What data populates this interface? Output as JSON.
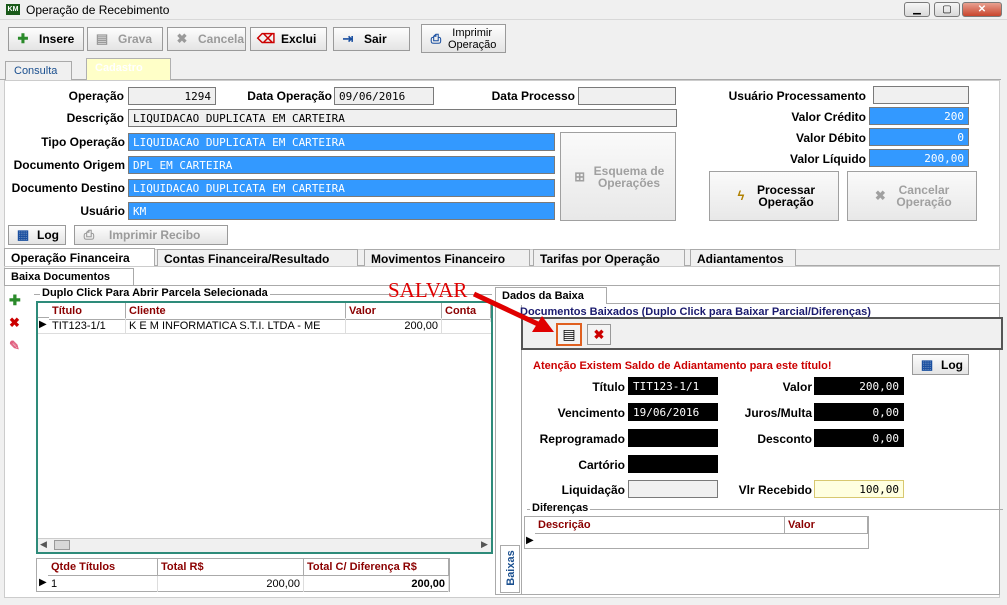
{
  "window": {
    "title": "Operação de Recebimento",
    "icon": "KM"
  },
  "toolbar": {
    "insere": "Insere",
    "grava": "Grava",
    "cancela": "Cancela",
    "exclui": "Exclui",
    "sair": "Sair",
    "imprimir_l1": "Imprimir",
    "imprimir_l2": "Operação"
  },
  "tabs": {
    "consulta": "Consulta",
    "cadastro": "Cadastro"
  },
  "form": {
    "operacao_label": "Operação",
    "operacao": "1294",
    "data_operacao_label": "Data Operação",
    "data_operacao": "09/06/2016",
    "data_processo_label": "Data Processo",
    "data_processo": "",
    "descricao_label": "Descrição",
    "descricao": "LIQUIDACAO DUPLICATA EM CARTEIRA",
    "tipo_operacao_label": "Tipo Operação",
    "tipo_operacao": "LIQUIDACAO DUPLICATA EM CARTEIRA",
    "doc_origem_label": "Documento Origem",
    "doc_origem": "DPL EM CARTEIRA",
    "doc_destino_label": "Documento Destino",
    "doc_destino": "LIQUIDACAO DUPLICATA EM CARTEIRA",
    "usuario_label": "Usuário",
    "usuario": "KM",
    "usuario_proc_label": "Usuário Processamento",
    "usuario_proc": "",
    "valor_credito_label": "Valor Crédito",
    "valor_credito": "200",
    "valor_debito_label": "Valor Débito",
    "valor_debito": "0",
    "valor_liquido_label": "Valor Líquido",
    "valor_liquido": "200,00"
  },
  "buttons": {
    "esquema_l1": "Esquema de",
    "esquema_l2": "Operações",
    "processar_l1": "Processar",
    "processar_l2": "Operação",
    "cancelar_l1": "Cancelar",
    "cancelar_l2": "Operação",
    "log": "Log",
    "imprimir_recibo": "Imprimir Recibo"
  },
  "subtabs": [
    "Operação Financeira",
    "Contas Financeira/Resultado",
    "Movimentos Financeiro",
    "Tarifas por Operação",
    "Adiantamentos"
  ],
  "baixa_docs": {
    "title": "Baixa Documentos",
    "group": "Duplo Click Para Abrir Parcela Selecionada",
    "columns": [
      "Título",
      "Cliente",
      "Valor",
      "Conta"
    ],
    "rows": [
      {
        "titulo": "TIT123-1/1",
        "cliente": "K E M INFORMATICA S.T.I. LTDA - ME",
        "valor": "200,00",
        "conta": ""
      }
    ],
    "summary_cols": [
      "Qtde Títulos",
      "Total R$",
      "Total C/ Diferença R$"
    ],
    "summary": {
      "qtde": "1",
      "total": "200,00",
      "total_dif": "200,00"
    }
  },
  "annotation": "SALVAR",
  "dados_baixa": {
    "tab": "Dados da Baixa",
    "group": "Documentos Baixados (Duplo Click para Baixar Parcial/Diferenças)",
    "warning": "Atenção Existem Saldo de Adiantamento para este título!",
    "log": "Log",
    "titulo_label": "Título",
    "titulo": "TIT123-1/1",
    "valor_label": "Valor",
    "valor": "200,00",
    "vencimento_label": "Vencimento",
    "vencimento": "19/06/2016",
    "juros_label": "Juros/Multa",
    "juros": "0,00",
    "reprogramado_label": "Reprogramado",
    "reprogramado": "",
    "desconto_label": "Desconto",
    "desconto": "0,00",
    "cartorio_label": "Cartório",
    "cartorio": "",
    "liquidacao_label": "Liquidação",
    "liquidacao": "",
    "vlr_recebido_label": "Vlr Recebido",
    "vlr_recebido": "100,00",
    "diferencas": "Diferenças",
    "dif_cols": [
      "Descrição",
      "Valor"
    ],
    "side_tab": "Baixas"
  },
  "colors": {
    "accent_blue": "#3399ff",
    "header_red": "#8b0000",
    "annot_red": "#e00000",
    "teal_border": "#2e8b7a"
  }
}
